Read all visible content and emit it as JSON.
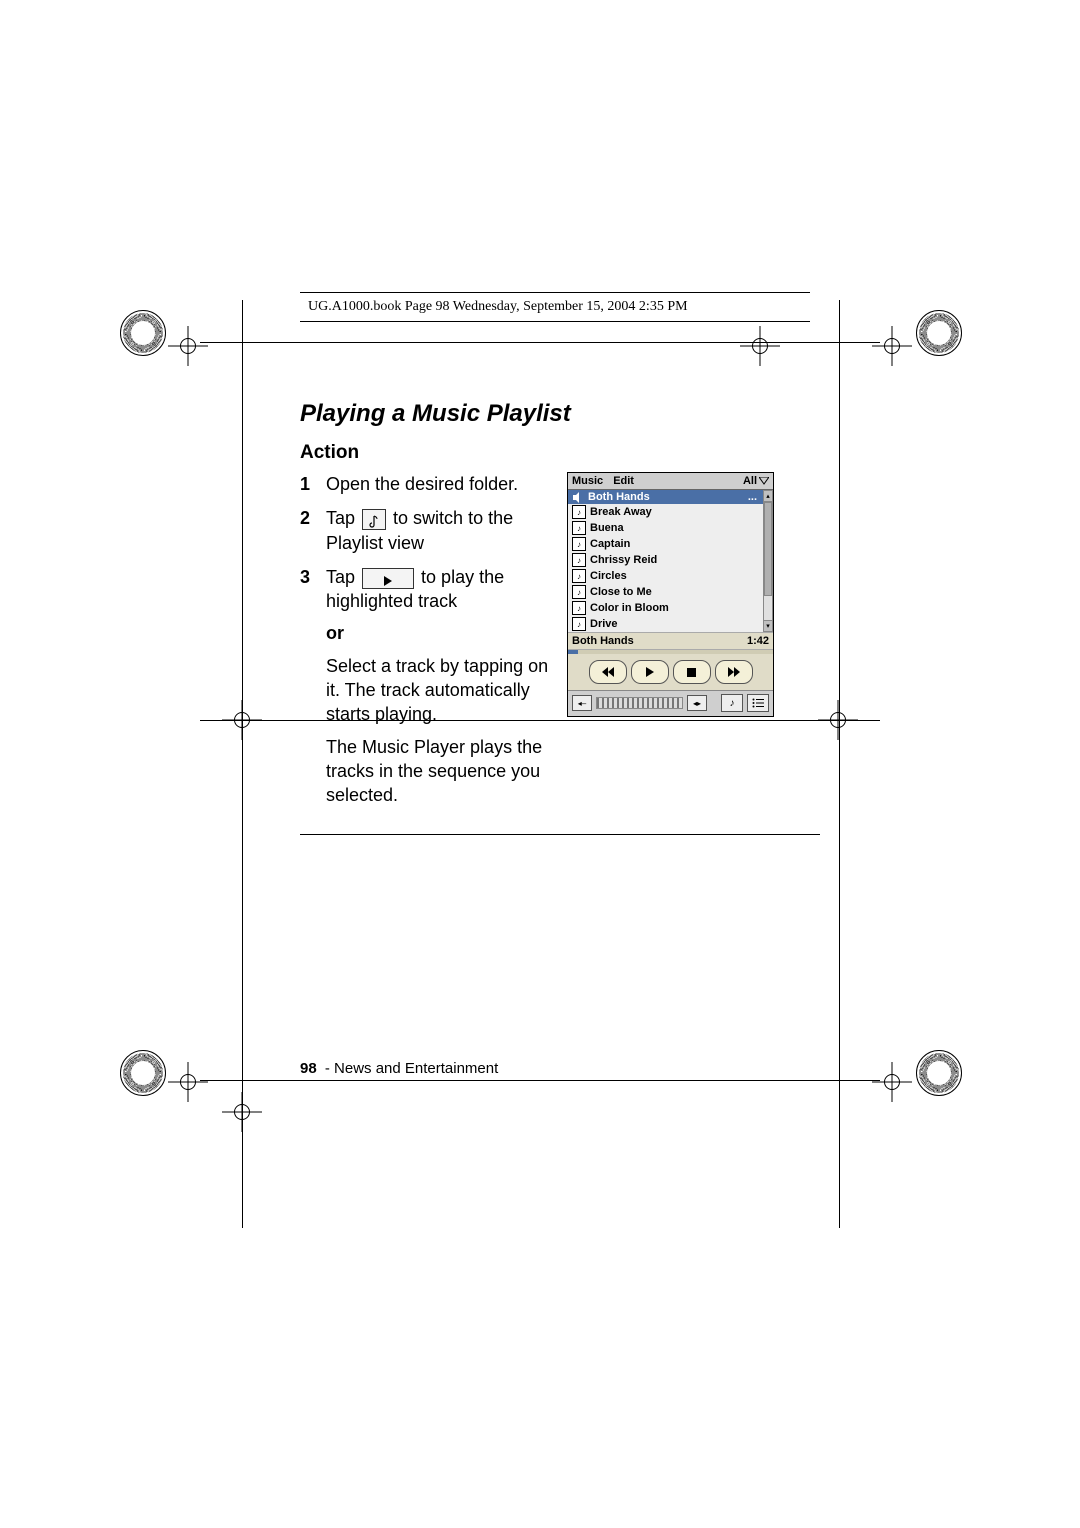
{
  "header_line": "UG.A1000.book  Page 98  Wednesday, September 15, 2004  2:35 PM",
  "title": "Playing a Music Playlist",
  "action_label": "Action",
  "steps": {
    "s1": {
      "num": "1",
      "text": "Open the desired folder."
    },
    "s2": {
      "num": "2",
      "pre": "Tap ",
      "post": " to switch to the Playlist view"
    },
    "s3": {
      "num": "3",
      "pre": "Tap ",
      "post": " to play the highlighted track",
      "or": "or",
      "alt": "Select a track by tapping on it. The track automatically starts playing.",
      "note2": "The Music Player plays the tracks in the sequence you selected."
    }
  },
  "phone": {
    "menu_music": "Music",
    "menu_edit": "Edit",
    "menu_all": "All",
    "tracks": [
      "Both Hands",
      "Break Away",
      "Buena",
      "Captain",
      "Chrissy Reid",
      "Circles",
      "Close to Me",
      "Color in Bloom",
      "Drive"
    ],
    "now_title": "Both Hands",
    "now_time": "1:42"
  },
  "footer": {
    "page": "98",
    "section": " - News and Entertainment"
  }
}
